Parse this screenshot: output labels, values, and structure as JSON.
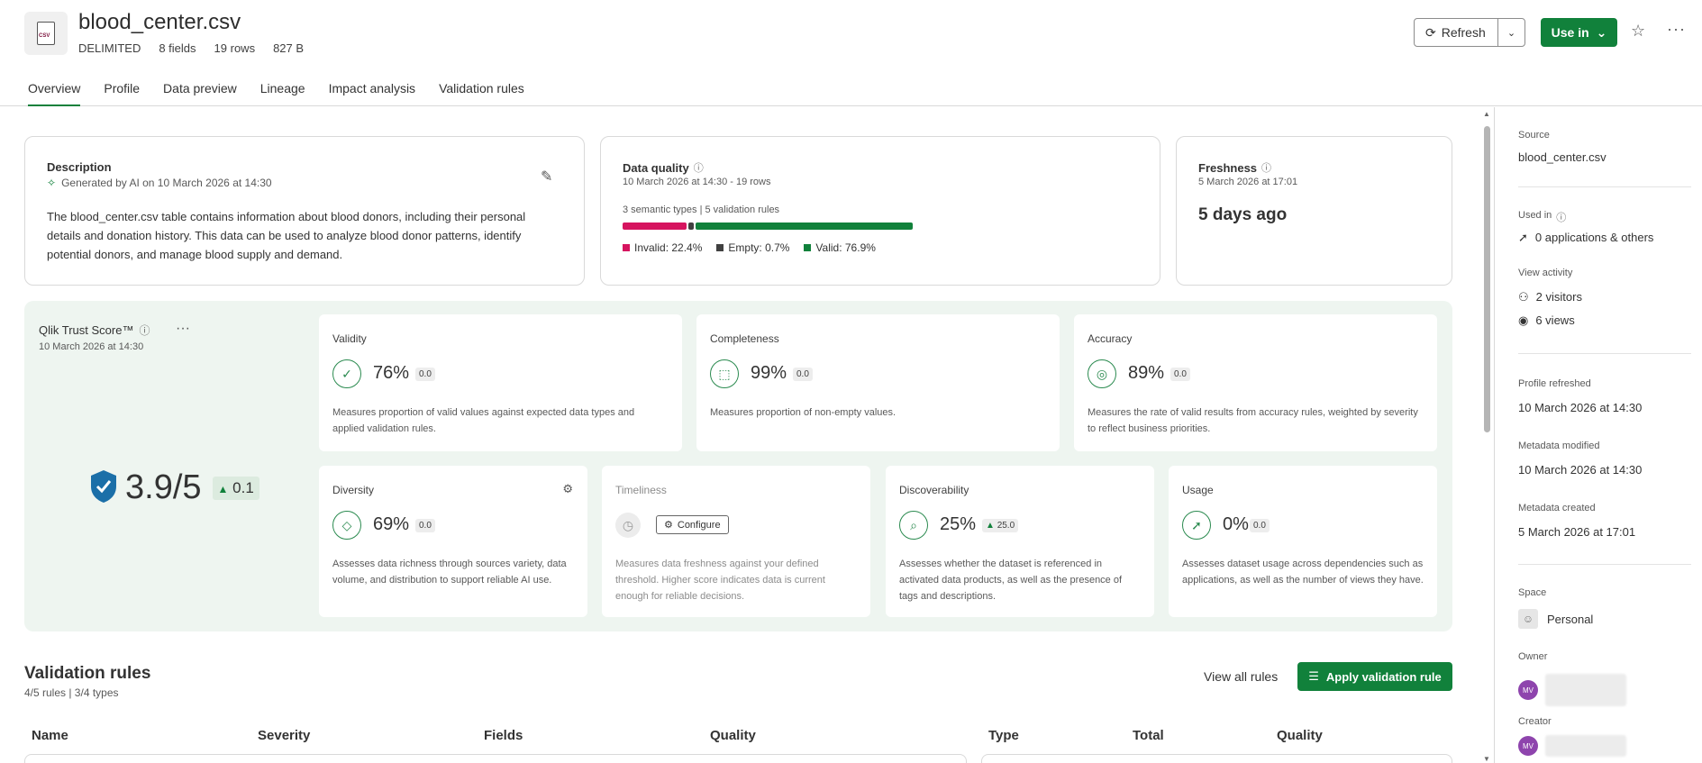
{
  "header": {
    "title": "blood_center.csv",
    "file_type_badge": "CSV",
    "type": "DELIMITED",
    "fields": "8 fields",
    "rows": "19 rows",
    "size": "827 B",
    "refresh_label": "Refresh",
    "use_in_label": "Use in"
  },
  "tabs": [
    "Overview",
    "Profile",
    "Data preview",
    "Lineage",
    "Impact analysis",
    "Validation rules"
  ],
  "description": {
    "title": "Description",
    "generated": "Generated by AI on 10 March 2026 at 14:30",
    "text": "The blood_center.csv table contains information about blood donors, including their personal details and donation history. This data can be used to analyze blood donor patterns, identify potential donors, and manage blood supply and demand."
  },
  "data_quality": {
    "title": "Data quality",
    "subtitle": "10 March 2026 at 14:30 - 19 rows",
    "types": "3 semantic types | 5 validation rules",
    "invalid": "Invalid: 22.4%",
    "empty": "Empty: 0.7%",
    "valid": "Valid: 76.9%",
    "invalid_pct": 22.4,
    "empty_pct": 0.7,
    "valid_pct": 76.9,
    "colors": {
      "invalid": "#d6145f",
      "empty": "#404040",
      "valid": "#11813b"
    }
  },
  "freshness": {
    "title": "Freshness",
    "date": "5 March 2026 at 17:01",
    "value": "5 days ago"
  },
  "trust": {
    "title": "Qlik Trust Score™",
    "date": "10 March 2026 at 14:30",
    "score": "3.9/5",
    "delta": "0.1"
  },
  "metrics": {
    "validity": {
      "title": "Validity",
      "value": "76%",
      "delta": "0.0",
      "desc": "Measures proportion of valid values against expected data types and applied validation rules."
    },
    "completeness": {
      "title": "Completeness",
      "value": "99%",
      "delta": "0.0",
      "desc": "Measures proportion of non-empty values."
    },
    "accuracy": {
      "title": "Accuracy",
      "value": "89%",
      "delta": "0.0",
      "desc": "Measures the rate of valid results from accuracy rules, weighted by severity to reflect business priorities."
    },
    "diversity": {
      "title": "Diversity",
      "value": "69%",
      "delta": "0.0",
      "desc": "Assesses data richness through sources variety, data volume, and distribution to support reliable AI use."
    },
    "timeliness": {
      "title": "Timeliness",
      "configure": "Configure",
      "desc": "Measures data freshness against your defined threshold. Higher score indicates data is current enough for reliable decisions."
    },
    "discoverability": {
      "title": "Discoverability",
      "value": "25%",
      "delta": "25.0",
      "desc": "Assesses whether the dataset is referenced in activated data products, as well as the presence of tags and descriptions."
    },
    "usage": {
      "title": "Usage",
      "value": "0%",
      "delta": "0.0",
      "desc": "Assesses dataset usage across dependencies such as applications, as well as the number of views they have."
    }
  },
  "validation": {
    "title": "Validation rules",
    "subtitle": "4/5 rules | 3/4 types",
    "view_all": "View all rules",
    "apply": "Apply validation rule",
    "left_cols": [
      "Name",
      "Severity",
      "Fields",
      "Quality"
    ],
    "right_cols": [
      "Type",
      "Total",
      "Quality"
    ]
  },
  "side": {
    "source_label": "Source",
    "source": "blood_center.csv",
    "used_in_label": "Used in",
    "used_in": "0 applications & others",
    "view_activity_label": "View activity",
    "visitors": "2 visitors",
    "views": "6 views",
    "profile_refreshed_label": "Profile refreshed",
    "profile_refreshed": "10 March 2026 at 14:30",
    "metadata_modified_label": "Metadata modified",
    "metadata_modified": "10 March 2026 at 14:30",
    "metadata_created_label": "Metadata created",
    "metadata_created": "5 March 2026 at 17:01",
    "space_label": "Space",
    "space": "Personal",
    "owner_label": "Owner",
    "owner_initials": "MV",
    "creator_label": "Creator",
    "creator_initials": "MV"
  }
}
